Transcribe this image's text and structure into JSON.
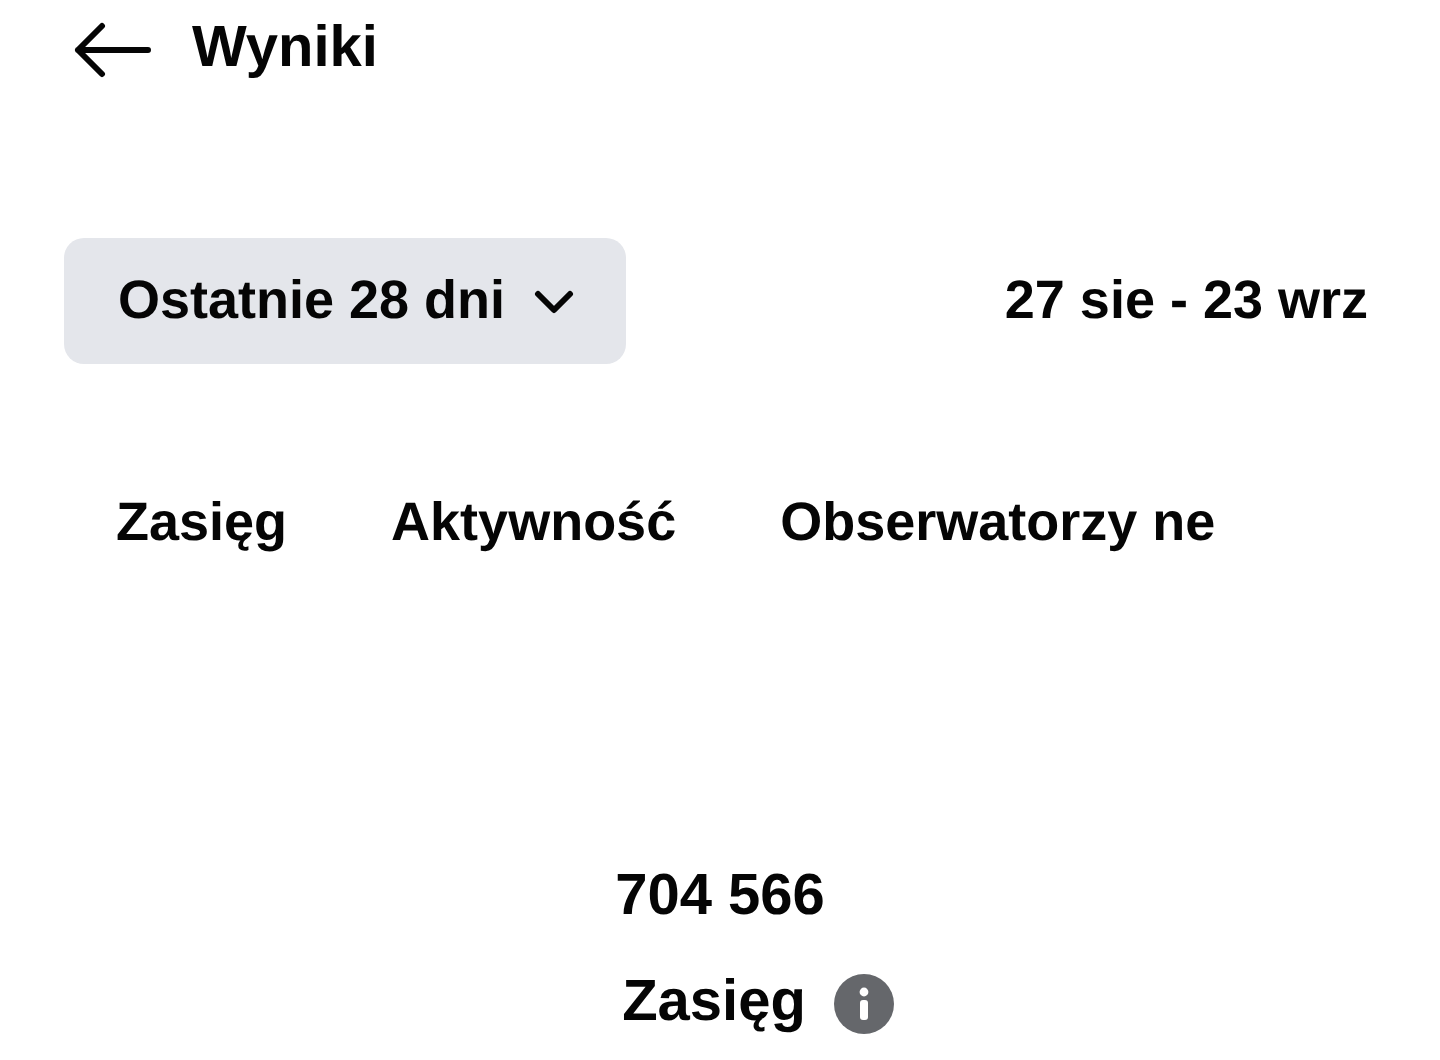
{
  "header": {
    "title": "Wyniki"
  },
  "period": {
    "dropdown": "Ostatnie 28 dni",
    "range": "27 sie - 23 wrz"
  },
  "tabs": [
    {
      "label": "Zasięg"
    },
    {
      "label": "Aktywność"
    },
    {
      "label": "Obserwatorzy ne"
    }
  ],
  "summary": {
    "value": "704 566",
    "label": "Zasięg"
  }
}
